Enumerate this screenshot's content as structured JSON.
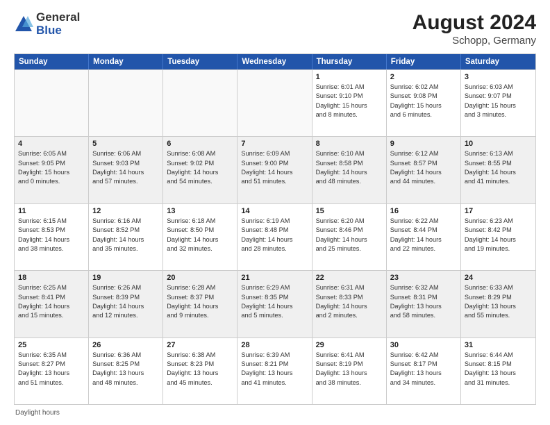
{
  "header": {
    "logo_general": "General",
    "logo_blue": "Blue",
    "month_year": "August 2024",
    "location": "Schopp, Germany"
  },
  "days_of_week": [
    "Sunday",
    "Monday",
    "Tuesday",
    "Wednesday",
    "Thursday",
    "Friday",
    "Saturday"
  ],
  "footer": {
    "note": "Daylight hours"
  },
  "weeks": [
    [
      {
        "day": "",
        "text": "",
        "empty": true
      },
      {
        "day": "",
        "text": "",
        "empty": true
      },
      {
        "day": "",
        "text": "",
        "empty": true
      },
      {
        "day": "",
        "text": "",
        "empty": true
      },
      {
        "day": "1",
        "text": "Sunrise: 6:01 AM\nSunset: 9:10 PM\nDaylight: 15 hours\nand 8 minutes."
      },
      {
        "day": "2",
        "text": "Sunrise: 6:02 AM\nSunset: 9:08 PM\nDaylight: 15 hours\nand 6 minutes."
      },
      {
        "day": "3",
        "text": "Sunrise: 6:03 AM\nSunset: 9:07 PM\nDaylight: 15 hours\nand 3 minutes."
      }
    ],
    [
      {
        "day": "4",
        "text": "Sunrise: 6:05 AM\nSunset: 9:05 PM\nDaylight: 15 hours\nand 0 minutes."
      },
      {
        "day": "5",
        "text": "Sunrise: 6:06 AM\nSunset: 9:03 PM\nDaylight: 14 hours\nand 57 minutes."
      },
      {
        "day": "6",
        "text": "Sunrise: 6:08 AM\nSunset: 9:02 PM\nDaylight: 14 hours\nand 54 minutes."
      },
      {
        "day": "7",
        "text": "Sunrise: 6:09 AM\nSunset: 9:00 PM\nDaylight: 14 hours\nand 51 minutes."
      },
      {
        "day": "8",
        "text": "Sunrise: 6:10 AM\nSunset: 8:58 PM\nDaylight: 14 hours\nand 48 minutes."
      },
      {
        "day": "9",
        "text": "Sunrise: 6:12 AM\nSunset: 8:57 PM\nDaylight: 14 hours\nand 44 minutes."
      },
      {
        "day": "10",
        "text": "Sunrise: 6:13 AM\nSunset: 8:55 PM\nDaylight: 14 hours\nand 41 minutes."
      }
    ],
    [
      {
        "day": "11",
        "text": "Sunrise: 6:15 AM\nSunset: 8:53 PM\nDaylight: 14 hours\nand 38 minutes."
      },
      {
        "day": "12",
        "text": "Sunrise: 6:16 AM\nSunset: 8:52 PM\nDaylight: 14 hours\nand 35 minutes."
      },
      {
        "day": "13",
        "text": "Sunrise: 6:18 AM\nSunset: 8:50 PM\nDaylight: 14 hours\nand 32 minutes."
      },
      {
        "day": "14",
        "text": "Sunrise: 6:19 AM\nSunset: 8:48 PM\nDaylight: 14 hours\nand 28 minutes."
      },
      {
        "day": "15",
        "text": "Sunrise: 6:20 AM\nSunset: 8:46 PM\nDaylight: 14 hours\nand 25 minutes."
      },
      {
        "day": "16",
        "text": "Sunrise: 6:22 AM\nSunset: 8:44 PM\nDaylight: 14 hours\nand 22 minutes."
      },
      {
        "day": "17",
        "text": "Sunrise: 6:23 AM\nSunset: 8:42 PM\nDaylight: 14 hours\nand 19 minutes."
      }
    ],
    [
      {
        "day": "18",
        "text": "Sunrise: 6:25 AM\nSunset: 8:41 PM\nDaylight: 14 hours\nand 15 minutes."
      },
      {
        "day": "19",
        "text": "Sunrise: 6:26 AM\nSunset: 8:39 PM\nDaylight: 14 hours\nand 12 minutes."
      },
      {
        "day": "20",
        "text": "Sunrise: 6:28 AM\nSunset: 8:37 PM\nDaylight: 14 hours\nand 9 minutes."
      },
      {
        "day": "21",
        "text": "Sunrise: 6:29 AM\nSunset: 8:35 PM\nDaylight: 14 hours\nand 5 minutes."
      },
      {
        "day": "22",
        "text": "Sunrise: 6:31 AM\nSunset: 8:33 PM\nDaylight: 14 hours\nand 2 minutes."
      },
      {
        "day": "23",
        "text": "Sunrise: 6:32 AM\nSunset: 8:31 PM\nDaylight: 13 hours\nand 58 minutes."
      },
      {
        "day": "24",
        "text": "Sunrise: 6:33 AM\nSunset: 8:29 PM\nDaylight: 13 hours\nand 55 minutes."
      }
    ],
    [
      {
        "day": "25",
        "text": "Sunrise: 6:35 AM\nSunset: 8:27 PM\nDaylight: 13 hours\nand 51 minutes."
      },
      {
        "day": "26",
        "text": "Sunrise: 6:36 AM\nSunset: 8:25 PM\nDaylight: 13 hours\nand 48 minutes."
      },
      {
        "day": "27",
        "text": "Sunrise: 6:38 AM\nSunset: 8:23 PM\nDaylight: 13 hours\nand 45 minutes."
      },
      {
        "day": "28",
        "text": "Sunrise: 6:39 AM\nSunset: 8:21 PM\nDaylight: 13 hours\nand 41 minutes."
      },
      {
        "day": "29",
        "text": "Sunrise: 6:41 AM\nSunset: 8:19 PM\nDaylight: 13 hours\nand 38 minutes."
      },
      {
        "day": "30",
        "text": "Sunrise: 6:42 AM\nSunset: 8:17 PM\nDaylight: 13 hours\nand 34 minutes."
      },
      {
        "day": "31",
        "text": "Sunrise: 6:44 AM\nSunset: 8:15 PM\nDaylight: 13 hours\nand 31 minutes."
      }
    ]
  ]
}
